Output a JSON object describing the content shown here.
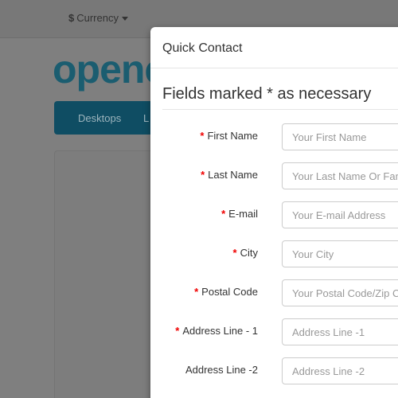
{
  "topbar": {
    "currency_symbol": "$",
    "currency_label": "Currency"
  },
  "store": {
    "logo_text": "openc",
    "menu_items": [
      "Desktops",
      "L"
    ]
  },
  "modal": {
    "title": "Quick Contact",
    "legend": "Fields marked * as necessary",
    "fields": [
      {
        "label": "First Name",
        "required": "*",
        "placeholder": "Your First Name"
      },
      {
        "label": "Last Name",
        "required": "*",
        "placeholder": "Your Last Name Or Family Name"
      },
      {
        "label": "E-mail",
        "required": "*",
        "placeholder": "Your E-mail Address"
      },
      {
        "label": "City",
        "required": "*",
        "placeholder": "Your City"
      },
      {
        "label": "Postal Code",
        "required": "*",
        "placeholder": "Your Postal Code/Zip Code"
      },
      {
        "label": "Address Line - 1",
        "required": "*",
        "placeholder": "Address Line -1"
      },
      {
        "label": "Address Line -2",
        "required": "",
        "placeholder": "Address Line -2"
      }
    ]
  },
  "colors": {
    "required_marker": "#f00000",
    "logo": "#1b5d70",
    "menu_bar": "#0f4d63"
  }
}
